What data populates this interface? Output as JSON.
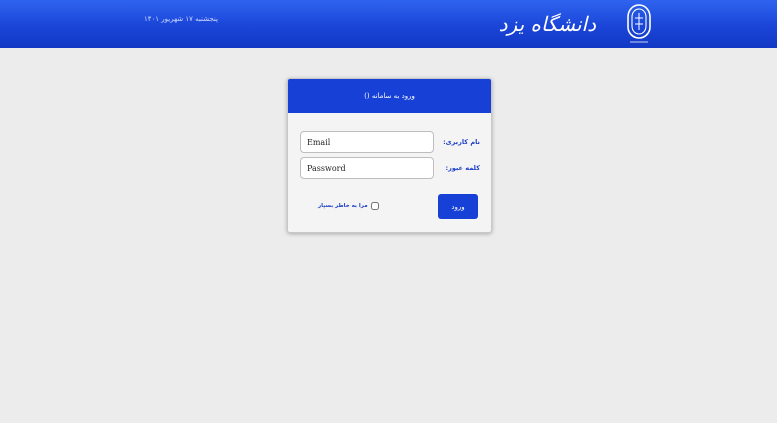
{
  "header": {
    "date_text": "پنجشنبه ۱۷ شهریور ۱۴۰۱",
    "logo_text": "دانشگاه یزد",
    "emblem_icon": "university-emblem-icon",
    "background_color": "#1a45d8"
  },
  "login": {
    "title": "ورود به سامانه ()",
    "username_label": "نام کاربری:",
    "username_placeholder": "Email",
    "password_label": "کلمه عبور:",
    "password_placeholder": "Password",
    "remember_label": "مرا به خاطر بسپار",
    "remember_checked": false,
    "submit_label": "ورود",
    "accent_color": "#1741d6"
  }
}
